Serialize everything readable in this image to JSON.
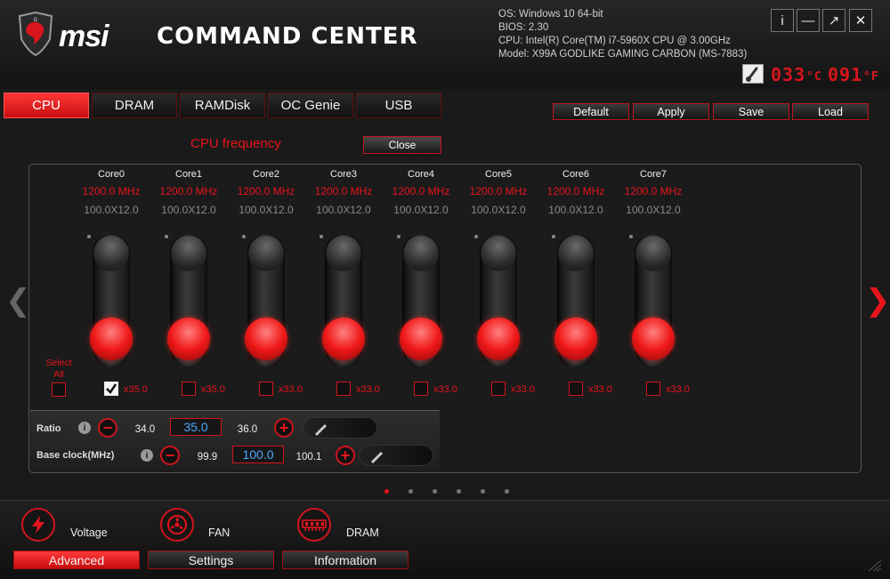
{
  "app": {
    "brand": "msi",
    "title": "COMMAND CENTER"
  },
  "system_info": {
    "os": "OS: Windows 10 64-bit",
    "bios": "BIOS: 2.30",
    "cpu": "CPU: Intel(R) Core(TM) i7-5960X CPU @ 3.00GHz",
    "model": "Model: X99A GODLIKE GAMING CARBON (MS-7883)"
  },
  "window_buttons": {
    "info": "i",
    "minimize": "—",
    "restore": "↗",
    "close": "✕"
  },
  "temperature": {
    "c_value": "033",
    "c_unit": "°C",
    "f_value": "091",
    "f_unit": "°F"
  },
  "tabs": [
    {
      "label": "CPU",
      "active": true
    },
    {
      "label": "DRAM"
    },
    {
      "label": "RAMDisk"
    },
    {
      "label": "OC Genie"
    },
    {
      "label": "USB"
    }
  ],
  "actions": {
    "default": "Default",
    "apply": "Apply",
    "save": "Save",
    "load": "Load"
  },
  "cpu_panel": {
    "title": "CPU frequency",
    "close": "Close",
    "select_all": "Select All",
    "cores": [
      {
        "name": "Core0",
        "freq": "1200.0 MHz",
        "ratio": "100.0X12.0",
        "max": "x35.0",
        "checked": true
      },
      {
        "name": "Core1",
        "freq": "1200.0 MHz",
        "ratio": "100.0X12.0",
        "max": "x35.0",
        "checked": false
      },
      {
        "name": "Core2",
        "freq": "1200.0 MHz",
        "ratio": "100.0X12.0",
        "max": "x33.0",
        "checked": false
      },
      {
        "name": "Core3",
        "freq": "1200.0 MHz",
        "ratio": "100.0X12.0",
        "max": "x33.0",
        "checked": false
      },
      {
        "name": "Core4",
        "freq": "1200.0 MHz",
        "ratio": "100.0X12.0",
        "max": "x33.0",
        "checked": false
      },
      {
        "name": "Core5",
        "freq": "1200.0 MHz",
        "ratio": "100.0X12.0",
        "max": "x33.0",
        "checked": false
      },
      {
        "name": "Core6",
        "freq": "1200.0 MHz",
        "ratio": "100.0X12.0",
        "max": "x33.0",
        "checked": false
      },
      {
        "name": "Core7",
        "freq": "1200.0 MHz",
        "ratio": "100.0X12.0",
        "max": "x33.0",
        "checked": false
      }
    ],
    "ratio": {
      "label": "Ratio",
      "prev": "34.0",
      "current": "35.0",
      "next": "36.0"
    },
    "base_clock": {
      "label": "Base clock(MHz)",
      "prev": "99.9",
      "current": "100.0",
      "next": "100.1"
    },
    "pager": {
      "count": 6,
      "active": 0
    }
  },
  "bottom": {
    "shortcuts": [
      {
        "label": "Voltage",
        "icon": "lightning-icon"
      },
      {
        "label": "FAN",
        "icon": "fan-icon"
      },
      {
        "label": "DRAM",
        "icon": "memory-icon"
      }
    ],
    "tabs": [
      {
        "label": "Advanced",
        "active": true
      },
      {
        "label": "Settings"
      },
      {
        "label": "Information"
      }
    ]
  },
  "colors": {
    "accent": "#e8141c",
    "value_blue": "#4aa8ff",
    "background": "#1a1a1a"
  }
}
